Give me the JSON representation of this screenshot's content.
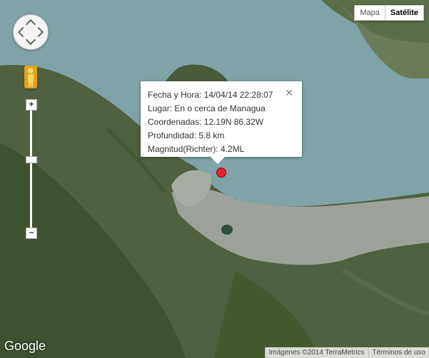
{
  "map_type": {
    "map_label": "Mapa",
    "satellite_label": "Satélite",
    "selected": "Satélite"
  },
  "info_window": {
    "fecha": "Fecha y Hora: 14/04/14 22:28:07",
    "lugar": "Lugar: En o cerca de Managua",
    "coords": "Coordenadas: 12.19N 86.32W",
    "profundidad": "Profundidad: 5.8 km",
    "magnitud": "Magnitud(Richter): 4.2ML",
    "close_symbol": "✕"
  },
  "zoom": {
    "in_label": "+",
    "out_label": "−"
  },
  "footer": {
    "logo": "Google",
    "imagery": "Imágenes ©2014 TerraMetrics",
    "terms": "Términos de uso"
  },
  "colors": {
    "lake": "#7fa3a6",
    "land": "#4f6140",
    "city": "#9ca29a",
    "marker": "#e3242b"
  }
}
